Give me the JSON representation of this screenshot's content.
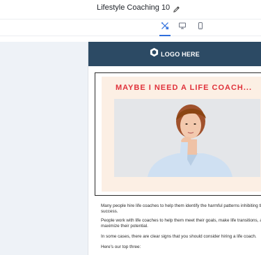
{
  "app": {
    "title": "Lifestyle Coaching 10"
  },
  "view_modes": [
    {
      "name": "design",
      "icon": "brush-ruler-icon",
      "active": true
    },
    {
      "name": "desktop",
      "icon": "monitor-icon",
      "active": false
    },
    {
      "name": "mobile",
      "icon": "smartphone-icon",
      "active": false
    }
  ],
  "email": {
    "logo_text": "LOGO HERE",
    "hero_title": "MAYBE I NEED A LIFE COACH...",
    "paragraphs": [
      "Many people hire life coaches to help them identify the harmful patterns inhibiting their success.",
      "People work with life coaches to help them meet their goals, make life transitions, and maximize their potential.",
      "In some cases, there are clear signs that you should consider hiring a life coach.",
      "Here's our top three:"
    ]
  },
  "colors": {
    "header_bg": "#2c4a64",
    "accent_blue": "#2f6fdd",
    "hero_title_red": "#e0323b",
    "hero_bg_peach": "#fcefe4",
    "side_panel": "#eef2f7"
  }
}
